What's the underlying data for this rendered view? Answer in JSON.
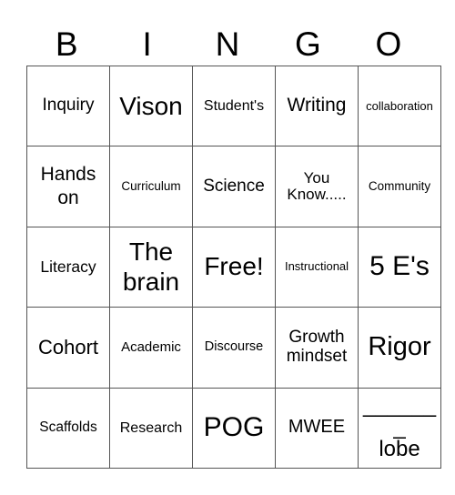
{
  "header": {
    "letters": [
      "B",
      "I",
      "N",
      "G",
      "O"
    ]
  },
  "card": {
    "rows": [
      [
        "Inquiry",
        "Vison",
        "Student's",
        "Writing",
        "collaboration"
      ],
      [
        "Hands on",
        "Curriculum",
        "Science",
        "You Know.....",
        "Community"
      ],
      [
        "Literacy",
        "The brain",
        "Free!",
        "Instructional",
        "5 E's"
      ],
      [
        "Cohort",
        "Academic",
        "Discourse",
        "Growth mindset",
        "Rigor"
      ],
      [
        "Scaffolds",
        "Research",
        "POG",
        "MWEE",
        "_______ lobe"
      ]
    ],
    "last_cell": {
      "blank": "_______",
      "word": "lobe"
    }
  },
  "colors": {
    "border": "#555555",
    "text": "#000000",
    "background": "#ffffff"
  }
}
